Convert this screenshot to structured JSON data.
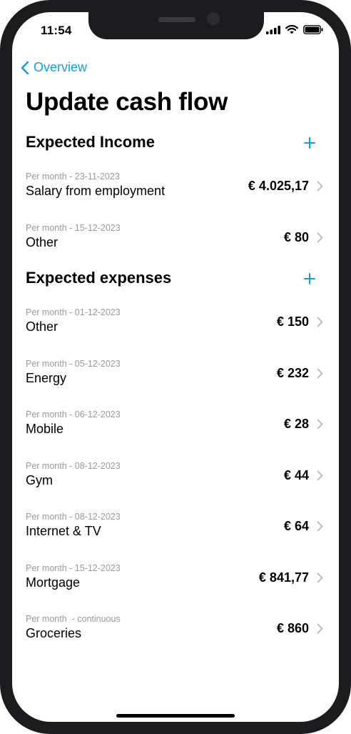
{
  "status": {
    "time": "11:54"
  },
  "nav": {
    "back_label": "Overview"
  },
  "page": {
    "title": "Update cash flow"
  },
  "income": {
    "title": "Expected Income",
    "items": [
      {
        "meta": "Per month - 23-11-2023",
        "name": "Salary from employment",
        "amount": "€ 4.025,17"
      },
      {
        "meta": "Per month - 15-12-2023",
        "name": "Other",
        "amount": "€ 80"
      }
    ]
  },
  "expenses": {
    "title": "Expected expenses",
    "items": [
      {
        "meta": "Per month - 01-12-2023",
        "name": "Other",
        "amount": "€ 150"
      },
      {
        "meta": "Per month - 05-12-2023",
        "name": "Energy",
        "amount": "€ 232"
      },
      {
        "meta": "Per month - 06-12-2023",
        "name": "Mobile",
        "amount": "€ 28"
      },
      {
        "meta": "Per month - 08-12-2023",
        "name": "Gym",
        "amount": "€ 44"
      },
      {
        "meta": "Per month - 08-12-2023",
        "name": "Internet & TV",
        "amount": "€ 64"
      },
      {
        "meta": "Per month - 15-12-2023",
        "name": "Mortgage",
        "amount": "€ 841,77"
      },
      {
        "meta": "Per month  - continuous",
        "name": "Groceries",
        "amount": "€ 860"
      }
    ]
  },
  "colors": {
    "accent": "#1a9bd7",
    "meta_text": "#9a9a9e",
    "frame": "#1c1c1e"
  },
  "icons": [
    "signal-icon",
    "wifi-icon",
    "battery-icon",
    "chevron-left-icon",
    "plus-icon",
    "chevron-right-icon"
  ]
}
